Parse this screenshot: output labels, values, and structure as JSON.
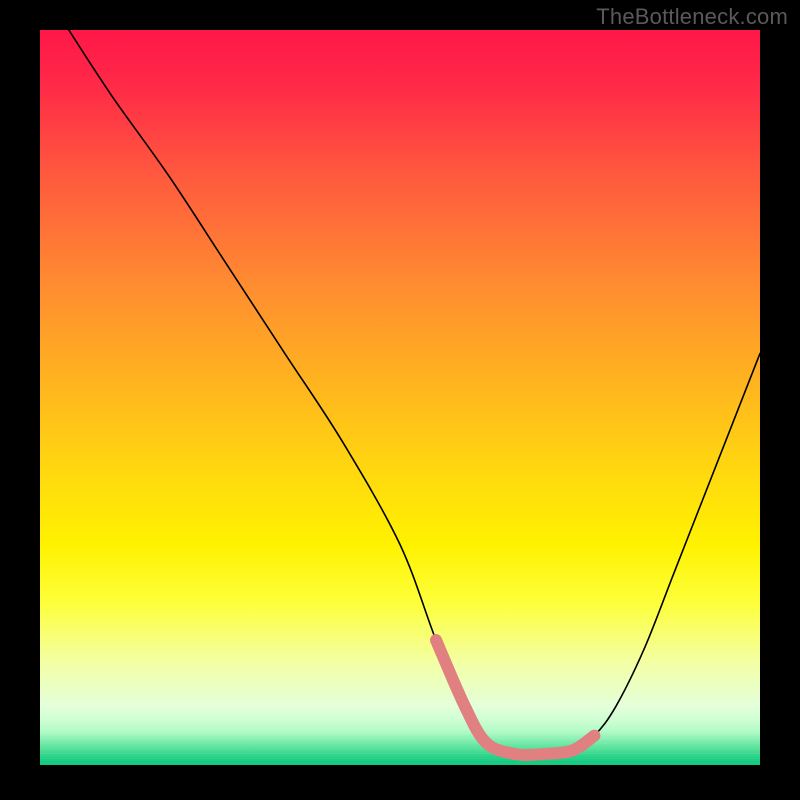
{
  "watermark": "TheBottleneck.com",
  "chart_data": {
    "type": "line",
    "title": "",
    "xlabel": "",
    "ylabel": "",
    "xlim": [
      0,
      100
    ],
    "ylim": [
      0,
      100
    ],
    "grid": false,
    "curve": {
      "name": "bottleneck-curve",
      "x": [
        4,
        10,
        18,
        26,
        34,
        42,
        50,
        55,
        59,
        62,
        66,
        70,
        74,
        77,
        80,
        84,
        88,
        92,
        96,
        100
      ],
      "y": [
        100,
        91,
        80,
        68,
        56,
        44,
        30,
        17,
        8,
        3,
        1.5,
        1.5,
        2,
        4,
        8,
        16,
        26,
        36,
        46,
        56
      ]
    },
    "highlight": {
      "name": "optimal-zone",
      "x_range": [
        57,
        77
      ],
      "y": 2,
      "color": "#e08080"
    },
    "gradient_stops": [
      {
        "pos": 0.0,
        "color": "#ff1748"
      },
      {
        "pos": 0.35,
        "color": "#ff8d30"
      },
      {
        "pos": 0.7,
        "color": "#fff200"
      },
      {
        "pos": 1.0,
        "color": "#09c77c"
      }
    ]
  }
}
